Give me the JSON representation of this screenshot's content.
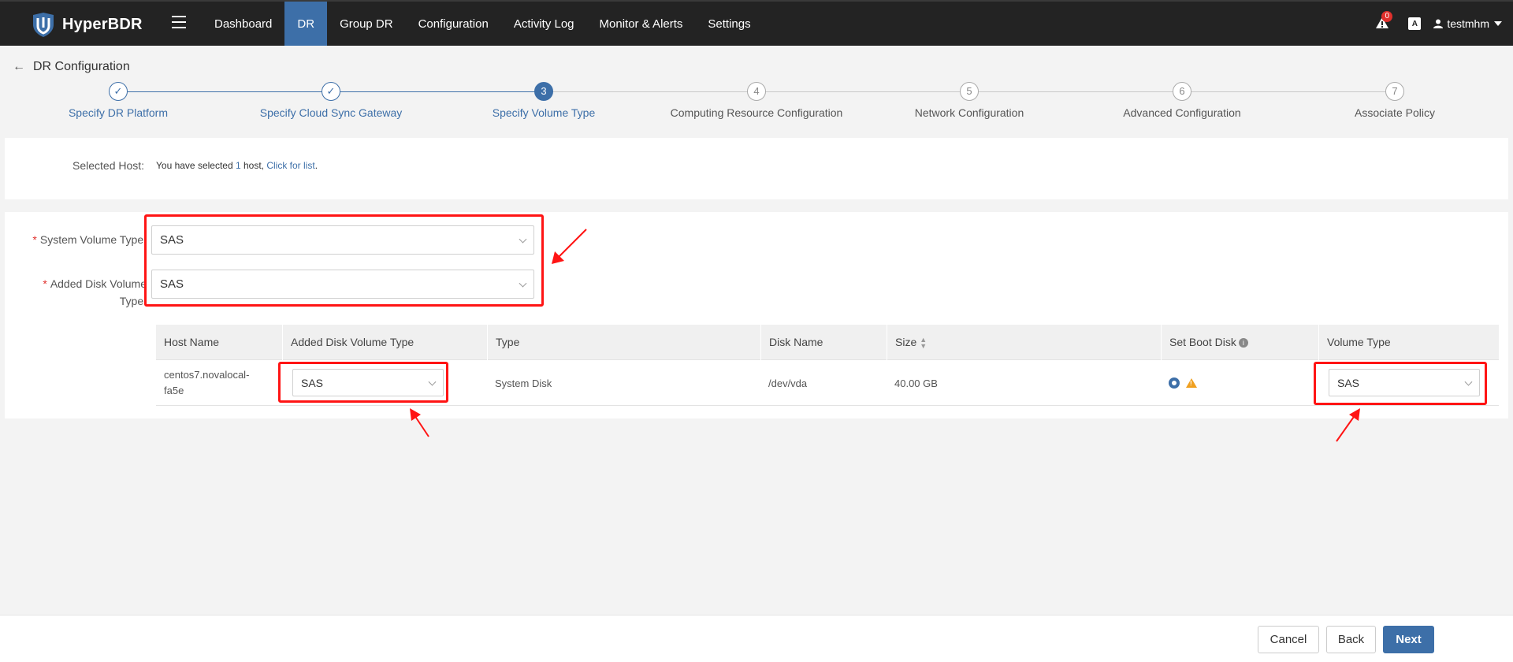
{
  "app": {
    "name": "HyperBDR"
  },
  "nav": {
    "items": [
      {
        "label": "Dashboard",
        "active": false
      },
      {
        "label": "DR",
        "active": true
      },
      {
        "label": "Group DR",
        "active": false
      },
      {
        "label": "Configuration",
        "active": false
      },
      {
        "label": "Activity Log",
        "active": false
      },
      {
        "label": "Monitor & Alerts",
        "active": false
      },
      {
        "label": "Settings",
        "active": false
      }
    ]
  },
  "topright": {
    "alert_count": "0",
    "lang_icon": "A",
    "user": "testmhm"
  },
  "page": {
    "title": "DR Configuration"
  },
  "steps": [
    {
      "num": "1",
      "label": "Specify DR Platform",
      "status": "done"
    },
    {
      "num": "2",
      "label": "Specify Cloud Sync Gateway",
      "status": "done"
    },
    {
      "num": "3",
      "label": "Specify Volume Type",
      "status": "current"
    },
    {
      "num": "4",
      "label": "Computing Resource Configuration",
      "status": "pending"
    },
    {
      "num": "5",
      "label": "Network Configuration",
      "status": "pending"
    },
    {
      "num": "6",
      "label": "Advanced Configuration",
      "status": "pending"
    },
    {
      "num": "7",
      "label": "Associate Policy",
      "status": "pending"
    }
  ],
  "selected_host": {
    "label": "Selected Host:",
    "text_prefix": "You have selected ",
    "count": "1",
    "text_mid": " host, ",
    "link": "Click for list",
    "text_suffix": "."
  },
  "form": {
    "system_volume_label": "System Volume Type:",
    "system_volume_value": "SAS",
    "added_disk_label_line1": "Added Disk Volume",
    "added_disk_label_line2": "Type:",
    "added_disk_value": "SAS"
  },
  "table": {
    "columns": [
      "Host Name",
      "Added Disk Volume Type",
      "Type",
      "Disk Name",
      "Size",
      "Set Boot Disk",
      "Volume Type"
    ],
    "rows": [
      {
        "host_line1": "centos7.novalocal-",
        "host_line2": "fa5e",
        "added_disk_type": "SAS",
        "type": "System Disk",
        "disk_name": "/dev/vda",
        "size": "40.00 GB",
        "volume_type": "SAS"
      }
    ]
  },
  "footer": {
    "cancel": "Cancel",
    "back": "Back",
    "next": "Next"
  },
  "colors": {
    "primary": "#3d6fa8",
    "navbar": "#232323",
    "annotation": "#ff1414"
  }
}
